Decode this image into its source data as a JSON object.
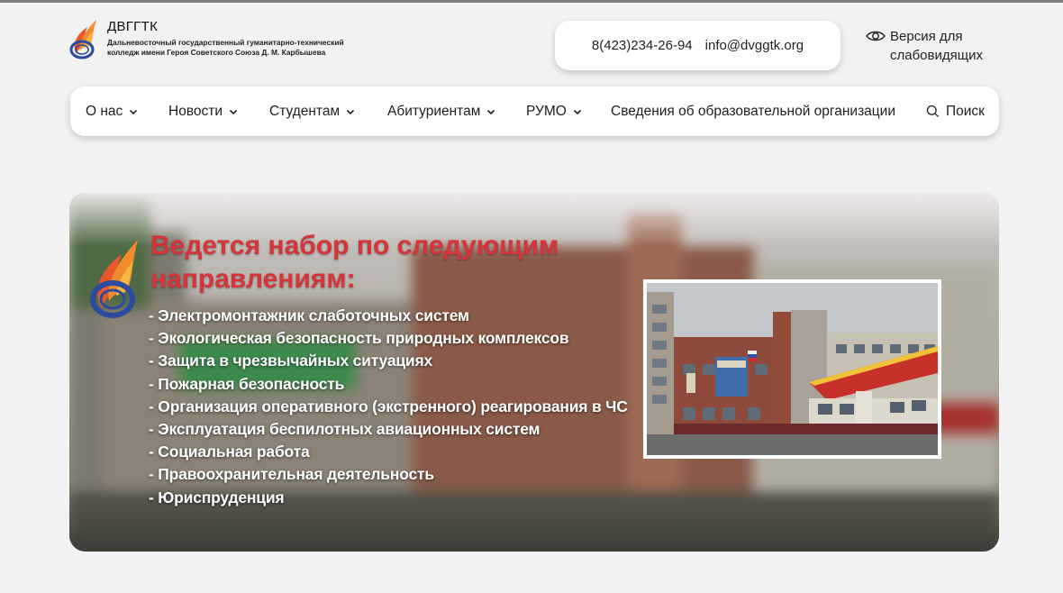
{
  "colors": {
    "accent_red": "#d4343a",
    "page_bg": "#f2f2f2",
    "card_bg": "#ffffff"
  },
  "header": {
    "logo_abbr": "ДВГГТК",
    "logo_full": "Дальневосточный государственный гуманитарно-технический колледж имени Героя Советского Союза Д. М. Карбышева",
    "phone": "8(423)234-26-94",
    "email": "info@dvggtk.org",
    "vision_label": "Версия для слабовидящих"
  },
  "nav": {
    "items": [
      {
        "label": "О нас",
        "dropdown": true
      },
      {
        "label": "Новости",
        "dropdown": true
      },
      {
        "label": "Студентам",
        "dropdown": true
      },
      {
        "label": "Абитуриентам",
        "dropdown": true
      },
      {
        "label": "РУМО",
        "dropdown": true
      },
      {
        "label": "Сведения об образовательной организации",
        "dropdown": false
      }
    ],
    "search_label": "Поиск"
  },
  "banner": {
    "title": "Ведется набор по следующим направлениям:",
    "programs": [
      "Электромонтажник слаботочных систем",
      "Экологическая безопасность природных комплексов",
      "Защита в чрезвычайных ситуациях",
      "Пожарная безопасность",
      "Организация оперативного (экстренного) реагирования в ЧС",
      "Эксплуатация беспилотных авиационных систем",
      "Социальная работа",
      "Правоохранительная деятельность",
      "Юриспруденция"
    ]
  }
}
